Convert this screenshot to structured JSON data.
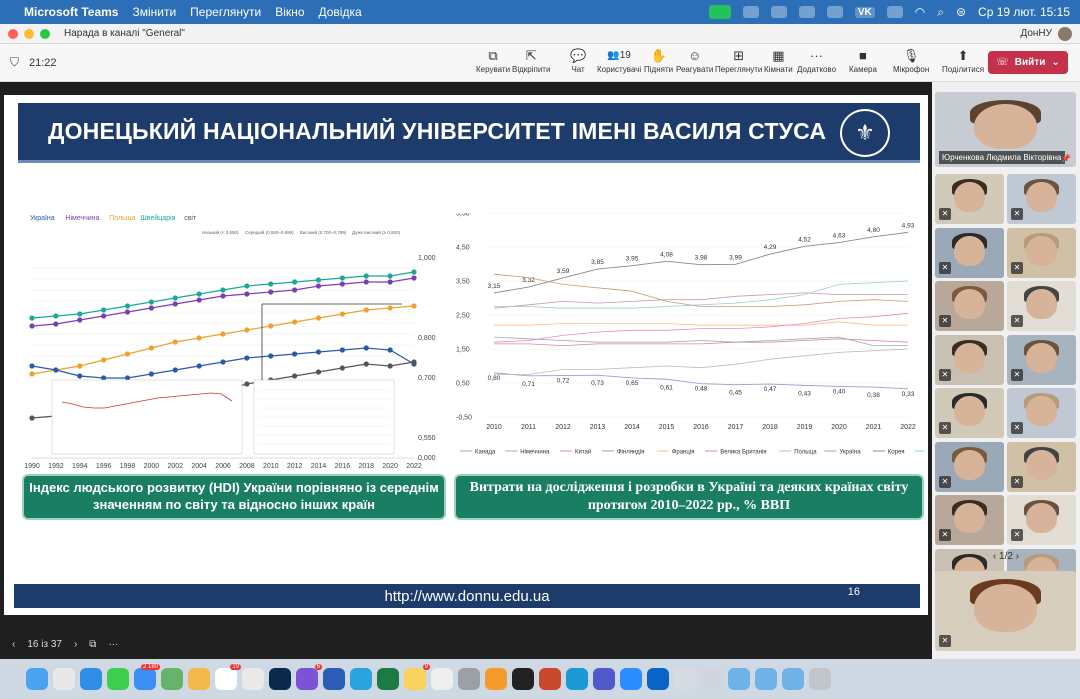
{
  "menubar": {
    "app": "Microsoft Teams",
    "items": [
      "Змінити",
      "Переглянути",
      "Вікно",
      "Довідка"
    ],
    "vk": "VK",
    "clock": "Ср 19 лют.  15:15"
  },
  "window": {
    "title": "Нарада в каналі \"General\"",
    "org": "ДонНУ"
  },
  "toolbar": {
    "timer": "21:22",
    "buttons": [
      {
        "label": "Керувати",
        "icon": "⧉"
      },
      {
        "label": "Відкріпити",
        "icon": "⇱"
      },
      {
        "label": "Чат",
        "icon": "💬"
      },
      {
        "label": "Користувачі",
        "icon": "👥",
        "count": "19"
      },
      {
        "label": "Підняти",
        "icon": "✋"
      },
      {
        "label": "Реагувати",
        "icon": "☺"
      },
      {
        "label": "Переглянути",
        "icon": "⊞"
      },
      {
        "label": "Кімнати",
        "icon": "▦"
      },
      {
        "label": "Додатково",
        "icon": "···"
      },
      {
        "label": "Камера",
        "icon": "■"
      },
      {
        "label": "Мікрофон",
        "icon": "🎙"
      },
      {
        "label": "Поділитися",
        "icon": "⬆"
      }
    ],
    "leave": "Вийти"
  },
  "slide": {
    "banner": "ДОНЕЦЬКИЙ НАЦІОНАЛЬНИЙ УНІВЕРСИТЕТ ІМЕНІ ВАСИЛЯ СТУСА",
    "caption_left": "Індекс людського розвитку (HDI) України порівняно із середнім значенням по світу та відносно інших країн",
    "caption_right": "Витрати на дослідження і розробки в Україні та деяких країнах світу протягом 2010–2022 рр., % ВВП",
    "footer_url": "http://www.donnu.edu.ua",
    "page_number": "16"
  },
  "chart_data": [
    {
      "type": "line",
      "legend": [
        "Україна",
        "Німеччина",
        "Польща",
        "Швейцарія",
        "світ"
      ],
      "legend_colors": [
        "#2a5aa8",
        "#7b3fb5",
        "#f0a02c",
        "#1aa89a",
        "#555555"
      ],
      "band_legend": [
        "Низький (< 0,550)",
        "Середній (0,550–0,699)",
        "Високий (0,700–0,799)",
        "Дуже високий (≥ 0,800)"
      ],
      "x": [
        1990,
        1992,
        1994,
        1996,
        1998,
        2000,
        2002,
        2004,
        2006,
        2008,
        2010,
        2012,
        2014,
        2016,
        2018,
        2020,
        2022
      ],
      "series": [
        {
          "name": "Швейцарія",
          "values": [
            0.85,
            0.855,
            0.86,
            0.87,
            0.88,
            0.89,
            0.9,
            0.91,
            0.92,
            0.93,
            0.935,
            0.94,
            0.945,
            0.95,
            0.955,
            0.955,
            0.965
          ]
        },
        {
          "name": "Німеччина",
          "values": [
            0.83,
            0.835,
            0.845,
            0.855,
            0.865,
            0.875,
            0.885,
            0.895,
            0.905,
            0.91,
            0.915,
            0.92,
            0.93,
            0.935,
            0.94,
            0.94,
            0.95
          ]
        },
        {
          "name": "Польща",
          "values": [
            0.71,
            0.72,
            0.73,
            0.745,
            0.76,
            0.775,
            0.79,
            0.8,
            0.81,
            0.82,
            0.83,
            0.84,
            0.85,
            0.86,
            0.87,
            0.875,
            0.88
          ]
        },
        {
          "name": "Україна",
          "values": [
            0.73,
            0.72,
            0.705,
            0.7,
            0.7,
            0.71,
            0.72,
            0.73,
            0.74,
            0.75,
            0.755,
            0.76,
            0.765,
            0.77,
            0.775,
            0.77,
            0.735
          ]
        },
        {
          "name": "світ",
          "values": [
            0.6,
            0.605,
            0.61,
            0.62,
            0.63,
            0.64,
            0.65,
            0.66,
            0.67,
            0.685,
            0.695,
            0.705,
            0.715,
            0.725,
            0.735,
            0.73,
            0.74
          ]
        }
      ],
      "yticks": [
        "1,000",
        "0,800",
        "0,700",
        "0,550",
        "0,000"
      ],
      "ylim": [
        0,
        1
      ]
    },
    {
      "type": "line",
      "x": [
        2010,
        2011,
        2012,
        2013,
        2014,
        2015,
        2016,
        2017,
        2018,
        2019,
        2020,
        2021,
        2022
      ],
      "yticks": [
        "5,50",
        "4,50",
        "3,50",
        "2,50",
        "1,50",
        "0,50",
        "-0,50"
      ],
      "ylim": [
        -0.5,
        5.5
      ],
      "series": [
        {
          "name": "Корея",
          "values": [
            3.15,
            3.32,
            3.59,
            3.85,
            3.95,
            4.08,
            3.98,
            3.99,
            4.29,
            4.52,
            4.63,
            4.8,
            4.93
          ],
          "labels": [
            "3,15",
            "3,32",
            "3,59",
            "3,85",
            "3,95",
            "4,08",
            "3,98",
            "3,99",
            "4,29",
            "4,52",
            "4,63",
            "4,80",
            "4,93"
          ]
        },
        {
          "name": "Україна",
          "values": [
            0.8,
            0.71,
            0.72,
            0.73,
            0.65,
            0.61,
            0.48,
            0.45,
            0.47,
            0.43,
            0.4,
            0.38,
            0.33
          ],
          "labels": [
            "0,80",
            "0,71",
            "0,72",
            "0,73",
            "0,65",
            "0,61",
            "0,48",
            "0,45",
            "0,47",
            "0,43",
            "0,40",
            "0,38",
            "0,33"
          ]
        },
        {
          "name": "Німеччина",
          "values": [
            2.7,
            2.8,
            2.9,
            2.85,
            2.9,
            2.95,
            2.95,
            3.05,
            3.1,
            3.15,
            3.1,
            3.1,
            3.1
          ]
        },
        {
          "name": "США",
          "values": [
            2.75,
            2.75,
            2.7,
            2.7,
            2.7,
            2.75,
            2.8,
            2.85,
            2.95,
            3.1,
            3.4,
            3.45,
            3.5
          ]
        },
        {
          "name": "Фінляндія",
          "values": [
            3.7,
            3.6,
            3.4,
            3.3,
            3.2,
            2.9,
            2.75,
            2.75,
            2.75,
            2.8,
            2.9,
            2.95,
            2.9
          ]
        },
        {
          "name": "Франція",
          "values": [
            2.2,
            2.2,
            2.25,
            2.25,
            2.25,
            2.25,
            2.2,
            2.2,
            2.2,
            2.2,
            2.3,
            2.2,
            2.2
          ]
        },
        {
          "name": "Велика Британія",
          "values": [
            1.65,
            1.65,
            1.6,
            1.65,
            1.65,
            1.65,
            1.65,
            1.7,
            1.7,
            1.75,
            1.8,
            1.75,
            1.7
          ]
        },
        {
          "name": "Канада",
          "values": [
            1.85,
            1.8,
            1.75,
            1.7,
            1.7,
            1.7,
            1.75,
            1.7,
            1.75,
            1.8,
            1.85,
            1.6,
            1.6
          ]
        },
        {
          "name": "Китай",
          "values": [
            1.7,
            1.75,
            1.9,
            2.0,
            2.05,
            2.05,
            2.1,
            2.1,
            2.15,
            2.25,
            2.4,
            2.45,
            2.55
          ]
        },
        {
          "name": "Польща",
          "values": [
            0.75,
            0.75,
            0.9,
            0.9,
            0.95,
            1.0,
            0.95,
            1.05,
            1.2,
            1.3,
            1.4,
            1.45,
            1.5
          ]
        }
      ],
      "legend": [
        "Канада",
        "Німеччина",
        "Китай",
        "Фінляндія",
        "Франція",
        "Велика Британія",
        "Польща",
        "Україна",
        "Корея",
        "США"
      ],
      "colors": [
        "#9ab",
        "#c9a",
        "#e8b",
        "#c97",
        "#fb8",
        "#d88",
        "#bbb",
        "#a9c",
        "#888",
        "#9cd"
      ]
    }
  ],
  "slide_nav": {
    "position": "16 із 37"
  },
  "participants": {
    "main_name": "Юрченкова Людмила Вікторівна",
    "pager": "1/2",
    "tiles": 16
  },
  "dock": {
    "badges": {
      "calendar": "19",
      "mail": "2 180",
      "notes": "9",
      "extra": "6"
    }
  }
}
